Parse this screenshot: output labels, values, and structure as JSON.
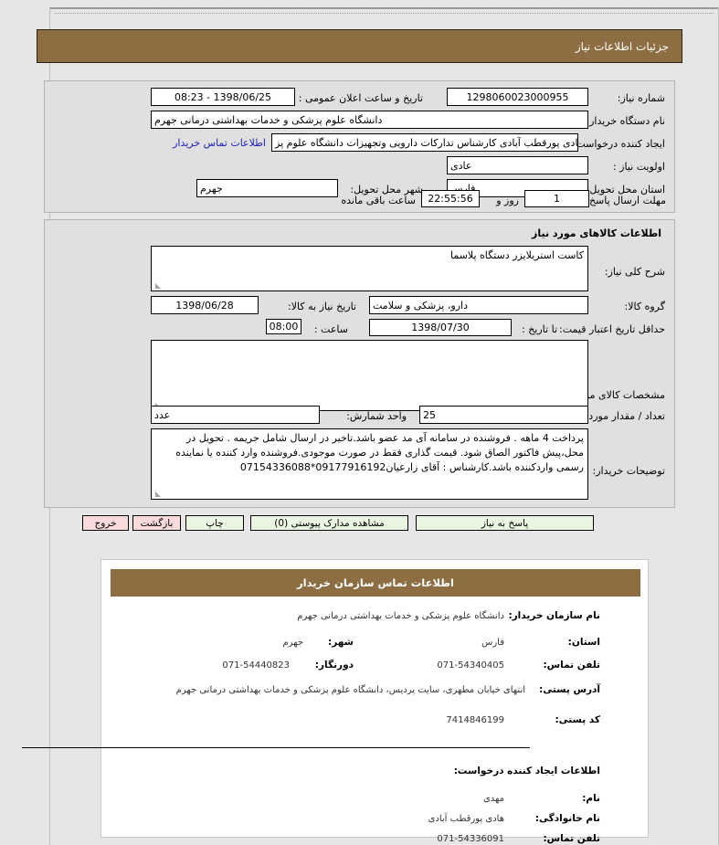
{
  "page": {
    "title": "جزئیات اطلاعات نیاز"
  },
  "need_info": {
    "need_number_label": "شماره نیاز:",
    "need_number_value": "1298060023000955",
    "announce_datetime_label": "تاریخ و ساعت اعلان عمومی :",
    "announce_datetime_value": "1398/06/25 - 08:23",
    "buyer_org_label": "نام دستگاه خریدار:",
    "buyer_org_value": "دانشگاه علوم پزشکی و خدمات بهداشتی درمانی جهرم",
    "requester_label": "ایجاد کننده درخواست:",
    "requester_value": "مهدی هادی پورقطب آبادی کارشناس تدارکات دارویی وتجهیزات دانشگاه علوم پز",
    "buyer_contact_link": "اطلاعات تماس خریدار",
    "priority_label": "اولویت نیاز :",
    "priority_value": "عادی",
    "delivery_province_label": "استان محل تحویل:",
    "delivery_province_value": "فارس",
    "delivery_city_label": "شهر محل تحویل:",
    "delivery_city_value": "جهرم",
    "response_deadline_label": "مهلت ارسال پاسخ:",
    "deadline_days_value": "1",
    "deadline_days_unit": "روز و",
    "deadline_time_value": "22:55:56",
    "deadline_time_unit": "ساعت باقی مانده"
  },
  "goods_info": {
    "heading": "اطلاعات کالاهای مورد نیاز",
    "general_desc_label": "شرح کلی نیاز:",
    "general_desc_value": "کاست استریلایزر دستگاه پلاسما",
    "goods_group_label": "گروه کالا:",
    "goods_group_value": "دارو، پزشکی و سلامت",
    "need_date_label": "تاریخ نیاز به کالا:",
    "need_date_value": "1398/06/28",
    "price_validity_label": "حداقل تاریخ اعتبار قیمت:",
    "price_validity_until_label": "تا تاریخ :",
    "price_validity_date": "1398/07/30",
    "price_validity_time_label": "ساعت :",
    "price_validity_time": "08:00",
    "specs_label": "مشخصات کالای مورد نیاز:",
    "specs_value": "",
    "quantity_label": "تعداد / مقدار مورد نیاز:",
    "quantity_value": "25",
    "unit_label": "واحد شمارش:",
    "unit_value": "عدد",
    "buyer_notes_label": "توضیحات خریدار:",
    "buyer_notes_value": "پرداخت 4 ماهه . فروشنده در سامانه آی مد عضو باشد.تاخیر در ارسال شامل جریمه  . تحویل در محل،پیش فاکتور الصاق شود. قیمت گذاری فقط در صورت موجودی.فروشنده وارد کننده یا نماینده رسمی واردکننده باشد.کارشناس : آقای زارعیان09177916192*07154336088"
  },
  "actions": {
    "respond": "پاسخ به نیاز",
    "view_attachments": "مشاهده مدارک پیوستی (0)",
    "print": "چاپ",
    "back": "بازگشت",
    "exit": "خروج"
  },
  "contact": {
    "heading": "اطلاعات تماس سازمان خریدار",
    "org_name_label": "نام سازمان خریدار:",
    "org_name_value": "دانشگاه علوم پزشکی و خدمات بهداشتی درمانی جهرم",
    "province_label": "استان:",
    "province_value": "فارس",
    "city_label": "شهر:",
    "city_value": "جهرم",
    "phone_label": "تلفن تماس:",
    "phone_value": "071-54340405",
    "fax_label": "دورنگار:",
    "fax_value": "071-54440823",
    "address_label": "آدرس پستی:",
    "address_value": "انتهای خیابان مطهری، سایت پردیس، دانشگاه علوم پزشکی و خدمات بهداشتی درمانی جهرم",
    "postal_label": "کد پستی:",
    "postal_value": "7414846199",
    "requester_section_title": "اطلاعات ایجاد کننده درخواست:",
    "first_name_label": "نام:",
    "first_name_value": "مهدی",
    "last_name_label": "نام خانوادگی:",
    "last_name_value": "هادی پورقطب آبادی",
    "req_phone_label": "تلفن تماس:",
    "req_phone_value": "071-54336091"
  },
  "colors": {
    "header_brown": "#8d6e43",
    "page_bg": "#e6e6e6",
    "panel_bg": "#e0e0e0",
    "button_green": "#eaf5e2",
    "button_pink": "#fadbdb",
    "link_blue": "#2020c0"
  }
}
